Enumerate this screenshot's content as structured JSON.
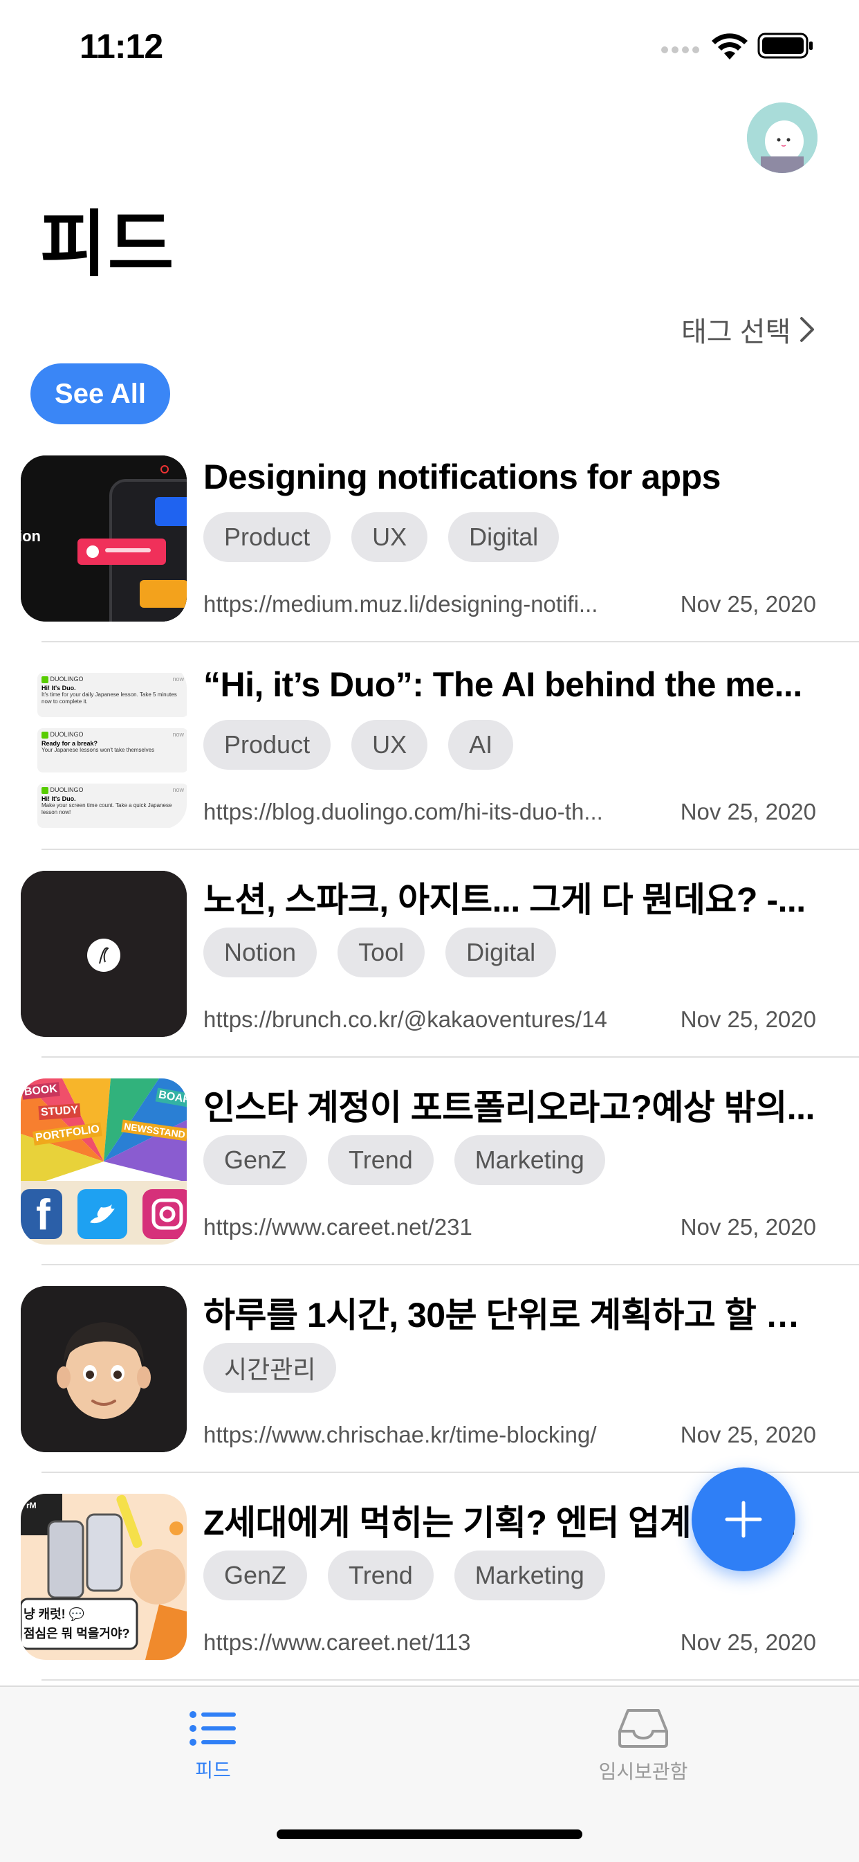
{
  "status_bar": {
    "time": "11:12"
  },
  "page_title": "피드",
  "tag_select_label": "태그 선택",
  "see_all_label": "See All",
  "feed": [
    {
      "title": "Designing notifications for apps",
      "tags": [
        "Product",
        "UX",
        "Digital"
      ],
      "url": "https://medium.muz.li/designing-notifi...",
      "date": "Nov 25, 2020",
      "thumb_text": "ion"
    },
    {
      "title": "“Hi, it’s Duo”: The AI behind the me...",
      "tags": [
        "Product",
        "UX",
        "AI"
      ],
      "url": "https://blog.duolingo.com/hi-its-duo-th...",
      "date": "Nov 25, 2020",
      "thumb_cards": [
        {
          "brand": "DUOLINGO",
          "time": "now",
          "title": "Hi! It's Duo.",
          "body": "It's time for your daily Japanese lesson. Take 5 minutes now to complete it."
        },
        {
          "brand": "DUOLINGO",
          "time": "now",
          "title": "Ready for a break?",
          "body": "Your Japanese lessons won't take themselves"
        },
        {
          "brand": "DUOLINGO",
          "time": "now",
          "title": "Hi! It's Duo.",
          "body": "Make your screen time count. Take a quick Japanese lesson now!"
        }
      ]
    },
    {
      "title": "노션, 스파크, 아지트... 그게 다 뭔데요? -...",
      "tags": [
        "Notion",
        "Tool",
        "Digital"
      ],
      "url": "https://brunch.co.kr/@kakaoventures/14",
      "date": "Nov 25, 2020"
    },
    {
      "title": "인스타 계정이 포트폴리오라고?예상 밖의...",
      "tags": [
        "GenZ",
        "Trend",
        "Marketing"
      ],
      "url": "https://www.careet.net/231",
      "date": "Nov 25, 2020",
      "thumb_words": [
        "BOOK",
        "STUDY",
        "PORTFOLIO",
        "NEWSSTAND",
        "BOAR"
      ]
    },
    {
      "title": "하루를 1시간, 30분 단위로 계획하고 할 일…",
      "tags": [
        "시간관리"
      ],
      "url": "https://www.chrischae.kr/time-blocking/",
      "date": "Nov 25, 2020"
    },
    {
      "title": "Z세대에게 먹히는 기획? 엔터 업계는 답을...",
      "tags": [
        "GenZ",
        "Trend",
        "Marketing"
      ],
      "url": "https://www.careet.net/113",
      "date": "Nov 25, 2020",
      "thumb_caption": [
        "냥 캐럿! 💬",
        "점심은 뭐 먹을거야?"
      ],
      "thumb_corner": "rM"
    }
  ],
  "tabs": [
    {
      "label": "피드",
      "icon": "list-icon",
      "active": true
    },
    {
      "label": "임시보관함",
      "icon": "inbox-tray-icon",
      "active": false
    }
  ],
  "colors": {
    "accent": "#2f7ff6",
    "tag_bg": "#e6e6e9",
    "text_secondary": "#555555"
  }
}
